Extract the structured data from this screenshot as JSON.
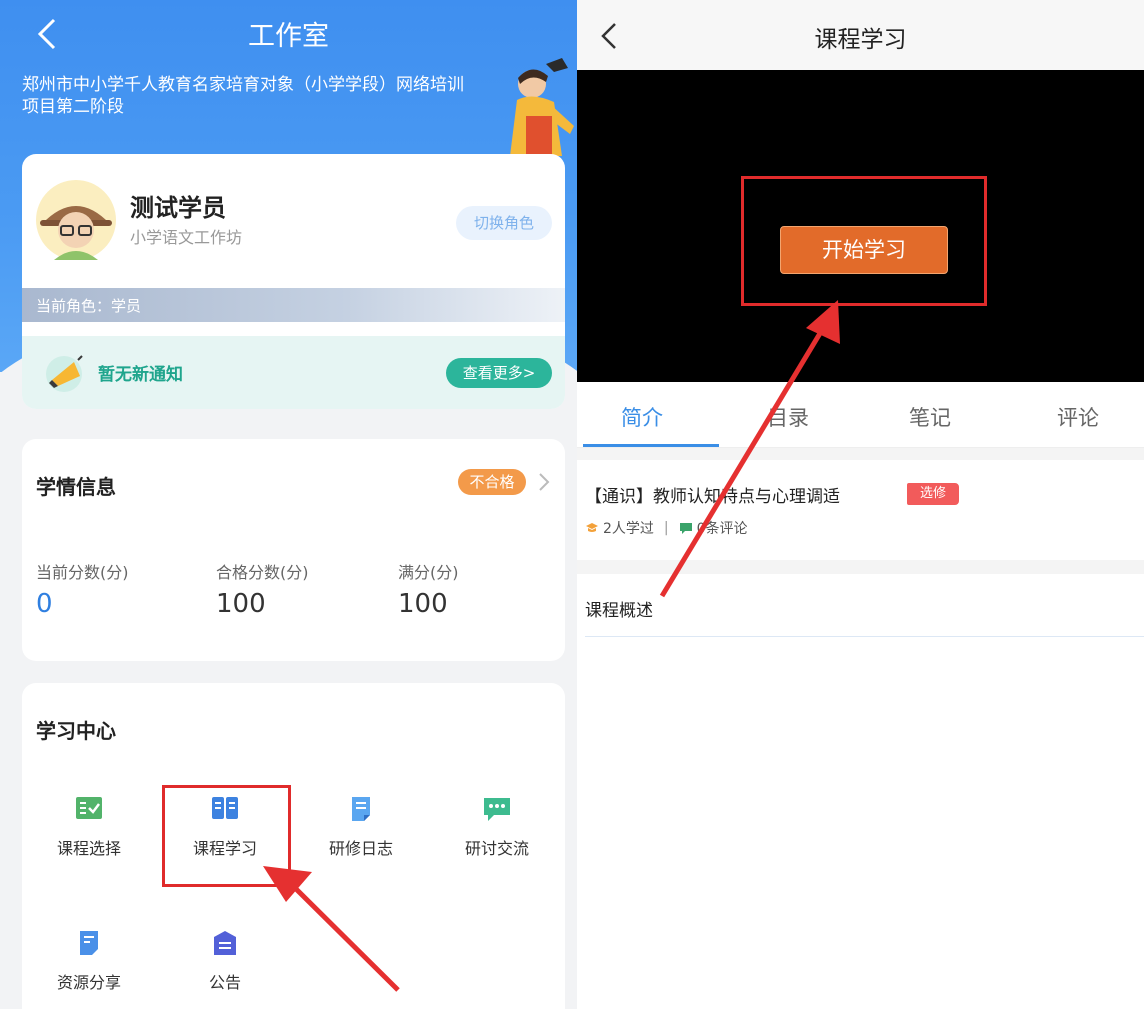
{
  "left": {
    "title": "工作室",
    "project_name": "郑州市中小学千人教育名家培育对象（小学学段）网络培训项目第二阶段",
    "user": {
      "name": "测试学员",
      "subtitle": "小学语文工作坊",
      "switch_role_label": "切换角色",
      "current_role": "当前角色：学员"
    },
    "notice": {
      "text": "暂无新通知",
      "more_label": "查看更多>"
    },
    "study_info": {
      "title": "学情信息",
      "status_badge": "不合格",
      "metrics": [
        {
          "label": "当前分数(分)",
          "value": "0"
        },
        {
          "label": "合格分数(分)",
          "value": "100"
        },
        {
          "label": "满分(分)",
          "value": "100"
        }
      ]
    },
    "learning_center": {
      "title": "学习中心",
      "items": [
        {
          "label": "课程选择",
          "icon": "course-select-icon"
        },
        {
          "label": "课程学习",
          "icon": "book-icon"
        },
        {
          "label": "研修日志",
          "icon": "journal-icon"
        },
        {
          "label": "研讨交流",
          "icon": "chat-icon"
        },
        {
          "label": "资源分享",
          "icon": "resource-icon"
        },
        {
          "label": "公告",
          "icon": "notice-box-icon"
        }
      ]
    }
  },
  "right": {
    "title": "课程学习",
    "start_button": "开始学习",
    "tabs": [
      "简介",
      "目录",
      "笔记",
      "评论"
    ],
    "course": {
      "title": "【通识】教师认知特点与心理调适",
      "tag": "选修",
      "learners": "2人学过",
      "separator": "|",
      "comments": "0条评论"
    },
    "overview_label": "课程概述"
  },
  "colors": {
    "header_blue": "#3f8ff0",
    "accent_blue": "#3a8ee6",
    "highlight_red": "#e02b2b",
    "start_orange": "#e26b2a",
    "teal": "#2cb59b",
    "badge_orange": "#f39a4a"
  }
}
